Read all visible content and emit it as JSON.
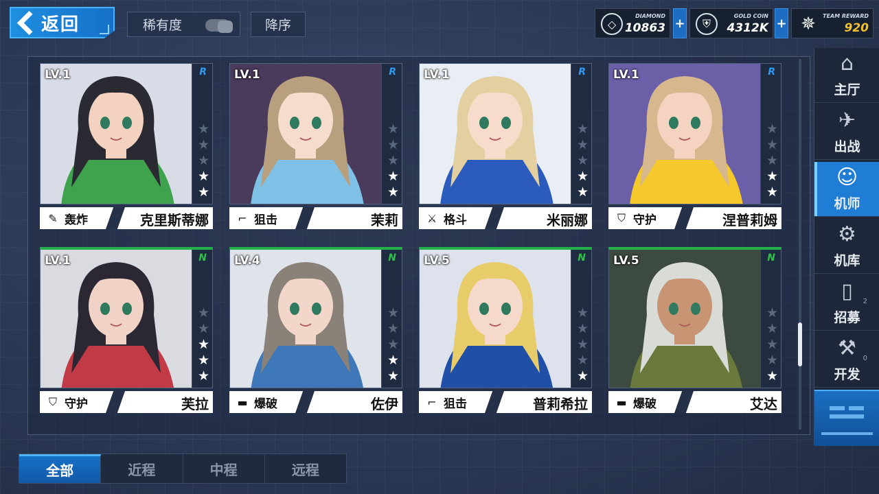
{
  "header": {
    "back_label": "返回",
    "rarity_label": "稀有度",
    "sort_label": "降序"
  },
  "resources": [
    {
      "name": "DIAMOND",
      "value": "10863",
      "icon": "diamond-icon"
    },
    {
      "name": "GOLD COIN",
      "value": "4312K",
      "icon": "gold-coin-icon"
    },
    {
      "name": "TEAM REWARD",
      "value": "920",
      "icon": "team-reward-icon"
    }
  ],
  "cards": [
    {
      "level": "LV.1",
      "rank": "R",
      "stars": 2,
      "role_icon": "bomb-icon",
      "role": "轰炸",
      "name": "克里斯蒂娜",
      "hair": "#2a2a33",
      "accent": "#3fa34d",
      "skin": "#f3d2c0",
      "bg": "#d8dce6"
    },
    {
      "level": "LV.1",
      "rank": "R",
      "stars": 2,
      "role_icon": "sniper-icon",
      "role": "狙击",
      "name": "茉莉",
      "hair": "#b89f7d",
      "accent": "#7fc1e6",
      "skin": "#f6dccd",
      "bg": "#4a3a5c"
    },
    {
      "level": "LV.1",
      "rank": "R",
      "stars": 2,
      "role_icon": "melee-icon",
      "role": "格斗",
      "name": "米丽娜",
      "hair": "#e3cfa0",
      "accent": "#2a5bbd",
      "skin": "#f7dccb",
      "bg": "#e9edf4"
    },
    {
      "level": "LV.1",
      "rank": "R",
      "stars": 2,
      "role_icon": "shield-icon",
      "role": "守护",
      "name": "涅普莉姆",
      "hair": "#d7b78d",
      "accent": "#f5c92b",
      "skin": "#f4d3c0",
      "bg": "#6b5fa8"
    },
    {
      "level": "LV.1",
      "rank": "N",
      "stars": 3,
      "role_icon": "shield-icon",
      "role": "守护",
      "name": "芙拉",
      "hair": "#2b2733",
      "accent": "#c23a46",
      "skin": "#f1d2c6",
      "bg": "#d9dbe1"
    },
    {
      "level": "LV.4",
      "rank": "N",
      "stars": 2,
      "role_icon": "blast-icon",
      "role": "爆破",
      "name": "佐伊",
      "hair": "#8a8278",
      "accent": "#3e78b8",
      "skin": "#f2d6c9",
      "bg": "#dfe3ea"
    },
    {
      "level": "LV.5",
      "rank": "N",
      "stars": 1,
      "role_icon": "sniper-icon",
      "role": "狙击",
      "name": "普莉希拉",
      "hair": "#e8cc6a",
      "accent": "#1f4fa6",
      "skin": "#f5dacb",
      "bg": "#dde2ec"
    },
    {
      "level": "LV.5",
      "rank": "N",
      "stars": 1,
      "role_icon": "blast-icon",
      "role": "爆破",
      "name": "艾达",
      "hair": "#d9dcd6",
      "accent": "#6a7a3c",
      "skin": "#c79574",
      "bg": "#3c4a40"
    }
  ],
  "sidebar": {
    "items": [
      {
        "label": "主厅",
        "icon": "hall-icon"
      },
      {
        "label": "出战",
        "icon": "sortie-icon"
      },
      {
        "label": "机师",
        "icon": "pilot-icon",
        "active": true
      },
      {
        "label": "机库",
        "icon": "hangar-icon"
      },
      {
        "label": "招募",
        "icon": "recruit-icon",
        "badge": "2"
      },
      {
        "label": "开发",
        "icon": "develop-icon",
        "badge": "0"
      }
    ]
  },
  "tabs": [
    {
      "label": "全部",
      "active": true
    },
    {
      "label": "近程",
      "active": false
    },
    {
      "label": "中程",
      "active": false
    },
    {
      "label": "远程",
      "active": false
    }
  ]
}
